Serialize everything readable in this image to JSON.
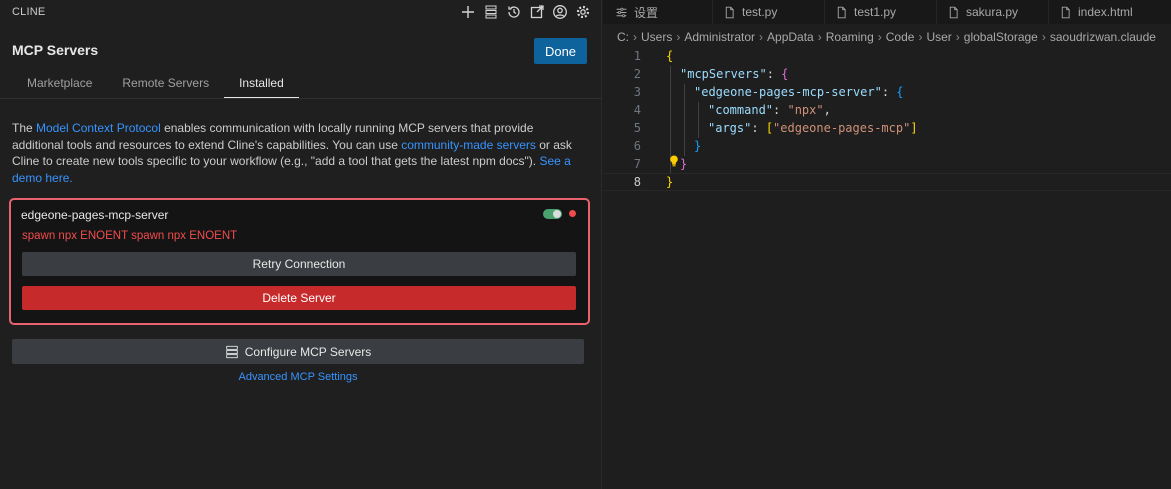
{
  "app": {
    "title": "CLINE",
    "actions": [
      "plus-icon",
      "server-stack-icon",
      "history-icon",
      "popout-icon",
      "account-icon",
      "gear-icon"
    ]
  },
  "header": {
    "title": "MCP Servers",
    "done_label": "Done"
  },
  "tabs": [
    {
      "label": "Marketplace",
      "active": false
    },
    {
      "label": "Remote Servers",
      "active": false
    },
    {
      "label": "Installed",
      "active": true
    }
  ],
  "description": {
    "p1": "The ",
    "link1": "Model Context Protocol",
    "p2": " enables communication with locally running MCP servers that provide additional tools and resources to extend Cline's capabilities. You can use ",
    "link2": "community-made servers",
    "p3": " or ask Cline to create new tools specific to your workflow (e.g., \"add a tool that gets the latest npm docs\"). ",
    "link3": "See a demo here."
  },
  "server": {
    "name": "edgeone-pages-mcp-server",
    "enabled": true,
    "status_color": "#f14c4c",
    "error": "spawn npx ENOENT spawn npx ENOENT",
    "retry_label": "Retry Connection",
    "delete_label": "Delete Server"
  },
  "footer": {
    "configure_label": "Configure MCP Servers",
    "advanced_label": "Advanced MCP Settings"
  },
  "editor": {
    "tabs": [
      {
        "label": "设置",
        "icon": "settings-icon"
      },
      {
        "label": "test.py",
        "icon": "file-icon"
      },
      {
        "label": "test1.py",
        "icon": "file-icon"
      },
      {
        "label": "sakura.py",
        "icon": "file-icon"
      },
      {
        "label": "index.html",
        "icon": "file-icon"
      }
    ],
    "breadcrumb": [
      "C:",
      "Users",
      "Administrator",
      "AppData",
      "Roaming",
      "Code",
      "User",
      "globalStorage",
      "saoudrizwan.claude"
    ],
    "current_line": 8,
    "lines": [
      {
        "n": "1",
        "tokens": [
          [
            "brace1",
            "{"
          ]
        ]
      },
      {
        "n": "2",
        "tokens": [
          [
            "key",
            "\"mcpServers\""
          ],
          [
            "punc",
            ": "
          ],
          [
            "brace2",
            "{"
          ]
        ]
      },
      {
        "n": "3",
        "tokens": [
          [
            "key",
            "\"edgeone-pages-mcp-server\""
          ],
          [
            "punc",
            ": "
          ],
          [
            "brace3",
            "{"
          ]
        ]
      },
      {
        "n": "4",
        "tokens": [
          [
            "key",
            "\"command\""
          ],
          [
            "punc",
            ": "
          ],
          [
            "str",
            "\"npx\""
          ],
          [
            "punc",
            ","
          ]
        ]
      },
      {
        "n": "5",
        "tokens": [
          [
            "key",
            "\"args\""
          ],
          [
            "punc",
            ": "
          ],
          [
            "brace1",
            "["
          ],
          [
            "str",
            "\"edgeone-pages-mcp\""
          ],
          [
            "brace1",
            "]"
          ]
        ]
      },
      {
        "n": "6",
        "tokens": [
          [
            "brace3",
            "}"
          ]
        ]
      },
      {
        "n": "7",
        "tokens": [
          [
            "brace2",
            "}"
          ]
        ]
      },
      {
        "n": "8",
        "tokens": [
          [
            "brace1",
            "}"
          ]
        ]
      }
    ]
  }
}
